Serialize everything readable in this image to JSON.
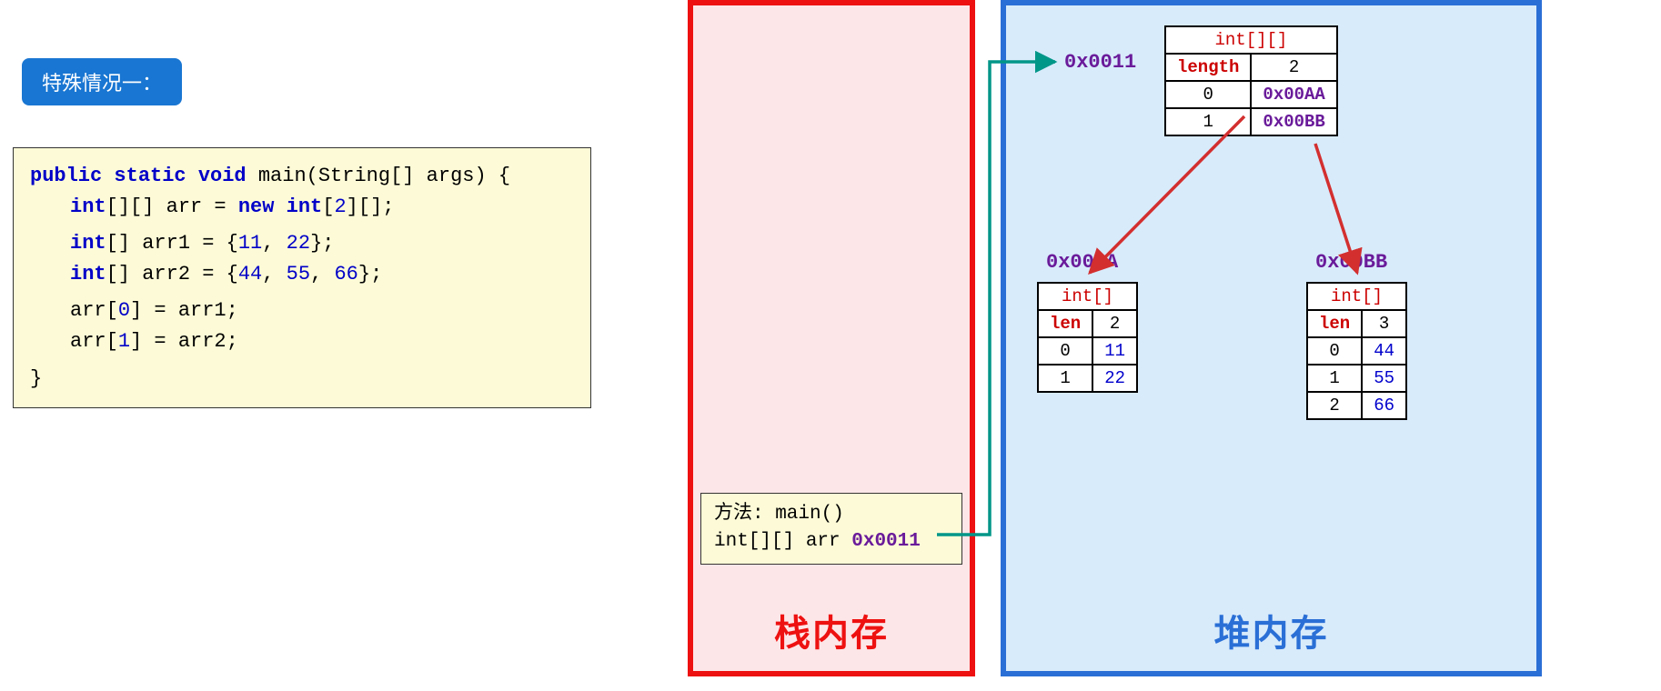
{
  "badge": {
    "text": "特殊情况一："
  },
  "code": {
    "l1a": "public static void",
    "l1b": " main(String[] args) {",
    "l2a": "int",
    "l2b": "[][] arr = ",
    "l2c": "new int",
    "l2d": "[",
    "l2e": "2",
    "l2f": "][];",
    "l3a": "int",
    "l3b": "[] arr1 = {",
    "l3c": "11",
    "l3d": ", ",
    "l3e": "22",
    "l3f": "};",
    "l4a": "int",
    "l4b": "[] arr2 = {",
    "l4c": "44",
    "l4d": ", ",
    "l4e": "55",
    "l4f": ", ",
    "l4g": "66",
    "l4h": "};",
    "l5": "arr[",
    "l5b": "0",
    "l5c": "] = arr1;",
    "l6": "arr[",
    "l6b": "1",
    "l6c": "] = arr2;",
    "l7": "}"
  },
  "stack": {
    "title": "栈内存",
    "frame": {
      "line1": "方法: main()",
      "line2a": "int[][] arr  ",
      "line2b": "0x0011"
    }
  },
  "heap": {
    "title": "堆内存",
    "outer": {
      "addr": "0x0011",
      "typeLabel": "int[][]",
      "lengthLabel": "length",
      "length": "2",
      "rows": [
        {
          "idx": "0",
          "val": "0x00AA"
        },
        {
          "idx": "1",
          "val": "0x00BB"
        }
      ]
    },
    "arrAA": {
      "addr": "0x00AA",
      "typeLabel": "int[]",
      "lenLabel": "len",
      "len": "2",
      "rows": [
        {
          "idx": "0",
          "val": "11"
        },
        {
          "idx": "1",
          "val": "22"
        }
      ]
    },
    "arrBB": {
      "addr": "0x00BB",
      "typeLabel": "int[]",
      "lenLabel": "len",
      "len": "3",
      "rows": [
        {
          "idx": "0",
          "val": "44"
        },
        {
          "idx": "1",
          "val": "55"
        },
        {
          "idx": "2",
          "val": "66"
        }
      ]
    }
  }
}
